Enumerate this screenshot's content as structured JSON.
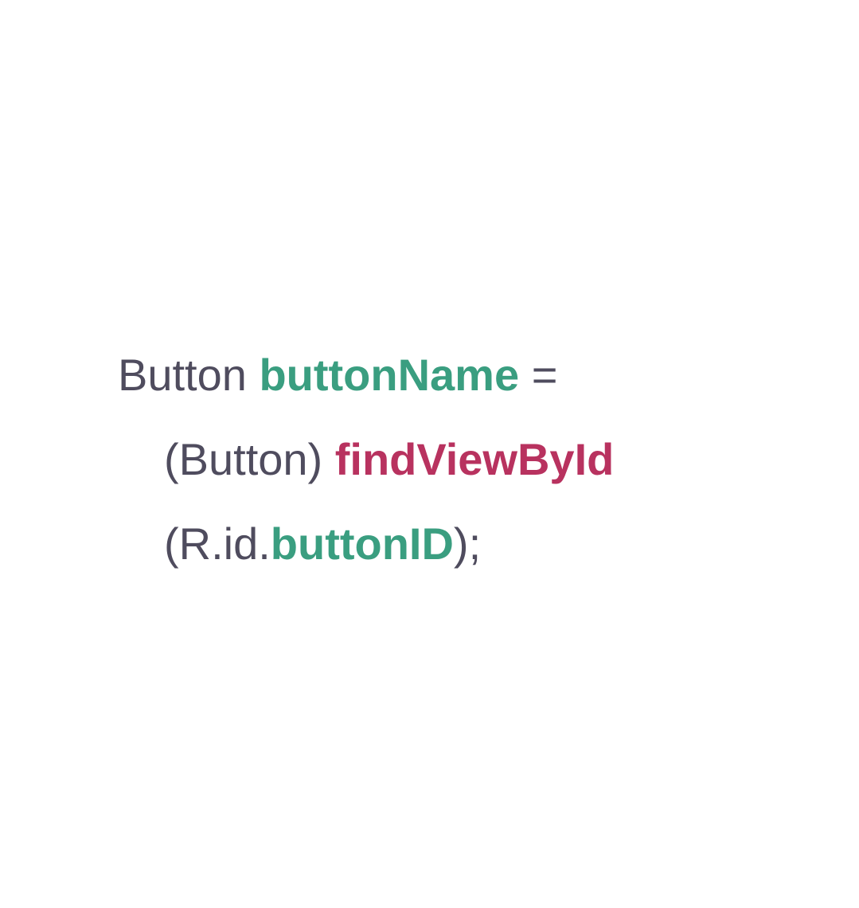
{
  "colors": {
    "plain": "#4f4c5e",
    "identifier": "#3a9e80",
    "method": "#b8325f",
    "background": "#ffffff"
  },
  "code": {
    "line1": {
      "type": "Button",
      "variable": "buttonName",
      "operator": "="
    },
    "line2": {
      "cast": "(Button)",
      "method": "findViewById"
    },
    "line3": {
      "open": "(R.id.",
      "id": "buttonID",
      "close": ");"
    }
  }
}
